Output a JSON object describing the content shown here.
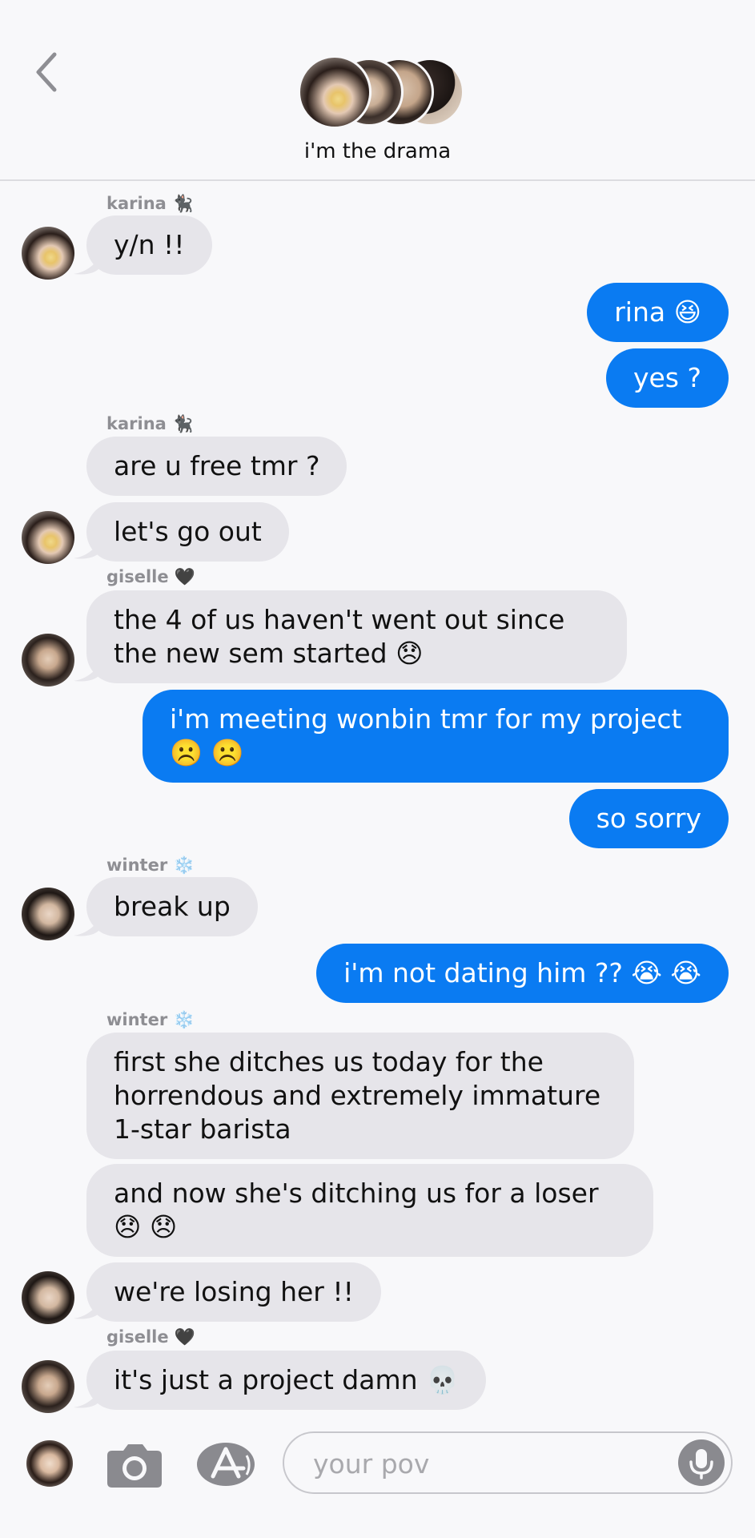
{
  "header": {
    "group_name": "i'm the drama"
  },
  "messages": [
    {
      "type": "sender",
      "text": "karina 🐈‍⬛"
    },
    {
      "type": "in",
      "text": "y/n !!"
    },
    {
      "type": "out",
      "text": "rina 😆"
    },
    {
      "type": "out",
      "text": "yes ?"
    },
    {
      "type": "sender",
      "text": "karina 🐈‍⬛"
    },
    {
      "type": "in",
      "text": "are u free tmr ?"
    },
    {
      "type": "in",
      "text": "let's go out"
    },
    {
      "type": "sender",
      "text": "giselle 🖤"
    },
    {
      "type": "in",
      "text": "the 4 of us haven't went out since the new sem started 😞"
    },
    {
      "type": "out",
      "text": "i'm meeting wonbin tmr for my project ☹️ ☹️"
    },
    {
      "type": "out",
      "text": "so sorry"
    },
    {
      "type": "sender",
      "text": "winter ❄️"
    },
    {
      "type": "in",
      "text": "break up"
    },
    {
      "type": "out",
      "text": "i'm not dating him ?? 😭 😭"
    },
    {
      "type": "sender",
      "text": "winter ❄️"
    },
    {
      "type": "in",
      "text": "first she ditches us today for the horrendous and extremely immature 1-star barista"
    },
    {
      "type": "in",
      "text": "and now she's ditching us for a loser 😞 😞"
    },
    {
      "type": "in",
      "text": "we're losing her !!"
    },
    {
      "type": "sender",
      "text": "giselle 🖤"
    },
    {
      "type": "in",
      "text": "it's just a project damn 💀"
    }
  ],
  "composer": {
    "placeholder": "your pov"
  },
  "colors": {
    "outgoing": "#0a7bf2",
    "incoming": "#e6e5ea",
    "background": "#f8f8fa"
  }
}
